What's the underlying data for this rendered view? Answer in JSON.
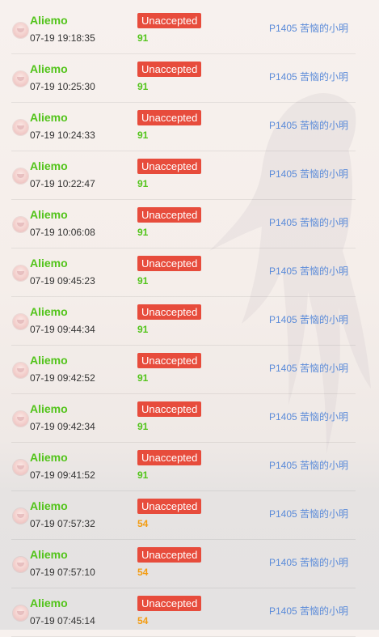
{
  "colors": {
    "score_mid": "#52c41a",
    "score_low": "#f39c12",
    "status_bg": "#e74c3c",
    "username": "#52c41a",
    "problem_link": "#5b8bd9"
  },
  "records": [
    {
      "user": "Aliemo",
      "time": "07-19 19:18:35",
      "status": "Unaccepted",
      "score": "91",
      "problem": "P1405 苦恼的小明"
    },
    {
      "user": "Aliemo",
      "time": "07-19 10:25:30",
      "status": "Unaccepted",
      "score": "91",
      "problem": "P1405 苦恼的小明"
    },
    {
      "user": "Aliemo",
      "time": "07-19 10:24:33",
      "status": "Unaccepted",
      "score": "91",
      "problem": "P1405 苦恼的小明"
    },
    {
      "user": "Aliemo",
      "time": "07-19 10:22:47",
      "status": "Unaccepted",
      "score": "91",
      "problem": "P1405 苦恼的小明"
    },
    {
      "user": "Aliemo",
      "time": "07-19 10:06:08",
      "status": "Unaccepted",
      "score": "91",
      "problem": "P1405 苦恼的小明"
    },
    {
      "user": "Aliemo",
      "time": "07-19 09:45:23",
      "status": "Unaccepted",
      "score": "91",
      "problem": "P1405 苦恼的小明"
    },
    {
      "user": "Aliemo",
      "time": "07-19 09:44:34",
      "status": "Unaccepted",
      "score": "91",
      "problem": "P1405 苦恼的小明"
    },
    {
      "user": "Aliemo",
      "time": "07-19 09:42:52",
      "status": "Unaccepted",
      "score": "91",
      "problem": "P1405 苦恼的小明"
    },
    {
      "user": "Aliemo",
      "time": "07-19 09:42:34",
      "status": "Unaccepted",
      "score": "91",
      "problem": "P1405 苦恼的小明"
    },
    {
      "user": "Aliemo",
      "time": "07-19 09:41:52",
      "status": "Unaccepted",
      "score": "91",
      "problem": "P1405 苦恼的小明"
    },
    {
      "user": "Aliemo",
      "time": "07-19 07:57:32",
      "status": "Unaccepted",
      "score": "54",
      "problem": "P1405 苦恼的小明"
    },
    {
      "user": "Aliemo",
      "time": "07-19 07:57:10",
      "status": "Unaccepted",
      "score": "54",
      "problem": "P1405 苦恼的小明"
    },
    {
      "user": "Aliemo",
      "time": "07-19 07:45:14",
      "status": "Unaccepted",
      "score": "54",
      "problem": "P1405 苦恼的小明"
    }
  ]
}
